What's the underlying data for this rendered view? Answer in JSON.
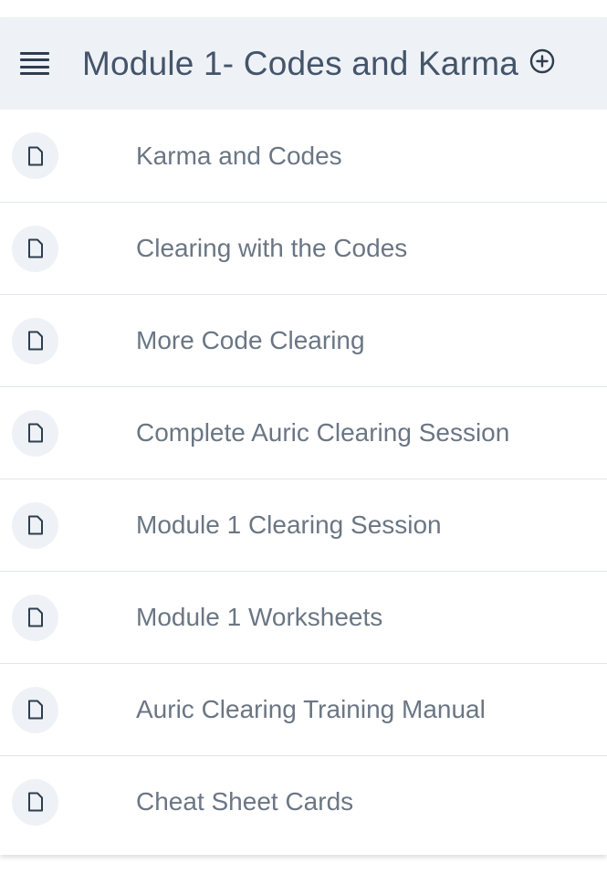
{
  "module": {
    "title": "Module 1- Codes and Karma",
    "icons": {
      "menu": "menu-icon",
      "expand": "plus-circle-icon",
      "lesson": "file-icon"
    },
    "lessons": [
      {
        "label": "Karma and Codes"
      },
      {
        "label": "Clearing with the Codes"
      },
      {
        "label": "More Code Clearing"
      },
      {
        "label": "Complete Auric Clearing Session"
      },
      {
        "label": "Module 1 Clearing Session"
      },
      {
        "label": "Module 1 Worksheets"
      },
      {
        "label": "Auric Clearing Training Manual"
      },
      {
        "label": "Cheat Sheet Cards"
      }
    ]
  },
  "colors": {
    "header_bg": "#eef2f6",
    "title_text": "#44546a",
    "lesson_text": "#6b7684",
    "divider": "#dfe5ec",
    "icon_dark": "#2f3d4f"
  }
}
